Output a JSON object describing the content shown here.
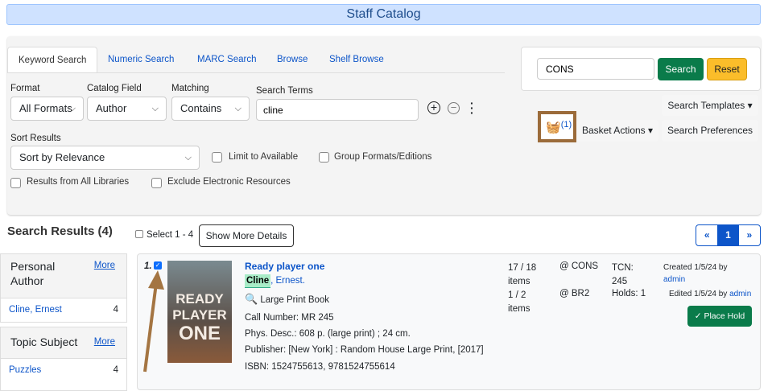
{
  "header": {
    "title": "Staff Catalog"
  },
  "tabs": [
    "Keyword Search",
    "Numeric Search",
    "MARC Search",
    "Browse",
    "Shelf Browse"
  ],
  "search": {
    "format_label": "Format",
    "format_value": "All Formats",
    "field_label": "Catalog Field",
    "field_value": "Author",
    "matching_label": "Matching",
    "matching_value": "Contains",
    "terms_label": "Search Terms",
    "terms_value": "cline",
    "sort_label": "Sort Results",
    "sort_value": "Sort by Relevance",
    "limit_available": "Limit to Available",
    "group_formats": "Group Formats/Editions",
    "all_libraries": "Results from All Libraries",
    "exclude_electronic": "Exclude Electronic Resources"
  },
  "org": {
    "value": "CONS",
    "search_label": "Search",
    "reset_label": "Reset"
  },
  "toolbar": {
    "templates": "Search Templates",
    "basket_count": "(1)",
    "basket_actions": "Basket Actions",
    "preferences": "Search Preferences"
  },
  "results": {
    "title": "Search Results (4)",
    "select_label": "Select 1 - 4",
    "more_details": "Show More Details",
    "pages": [
      "«",
      "1",
      "»"
    ]
  },
  "facets": [
    {
      "title": "Personal Author",
      "more": "More",
      "items": [
        {
          "label": "Cline, Ernest",
          "count": "4"
        }
      ]
    },
    {
      "title": "Topic Subject",
      "more": "More",
      "items": [
        {
          "label": "Puzzles",
          "count": "4"
        }
      ]
    }
  ],
  "record": {
    "index": "1.",
    "title": "Ready player one",
    "author_hl": "Cline",
    "author_rest": ", Ernest.",
    "format": "Large Print Book",
    "call_number": "Call Number: MR 245",
    "phys_desc": "Phys. Desc.: 608 p. (large print) ; 24 cm.",
    "publisher": "Publisher: [New York] : Random House Large Print, [2017]",
    "isbn": "ISBN: 1524755613, 9781524755614",
    "copies": [
      {
        "count": "17 / 18 items",
        "lib": "@ CONS"
      },
      {
        "count": "1 / 2 items",
        "lib": "@ BR2"
      }
    ],
    "tcn": "TCN: 245",
    "holds": "Holds: 1",
    "created": "Created 1/5/24 by",
    "created_by": "admin",
    "edited": "Edited 1/5/24 by",
    "edited_by": "admin",
    "place_hold": "Place Hold",
    "cover_text": [
      "READY",
      "PLAYER",
      "ONE"
    ]
  }
}
